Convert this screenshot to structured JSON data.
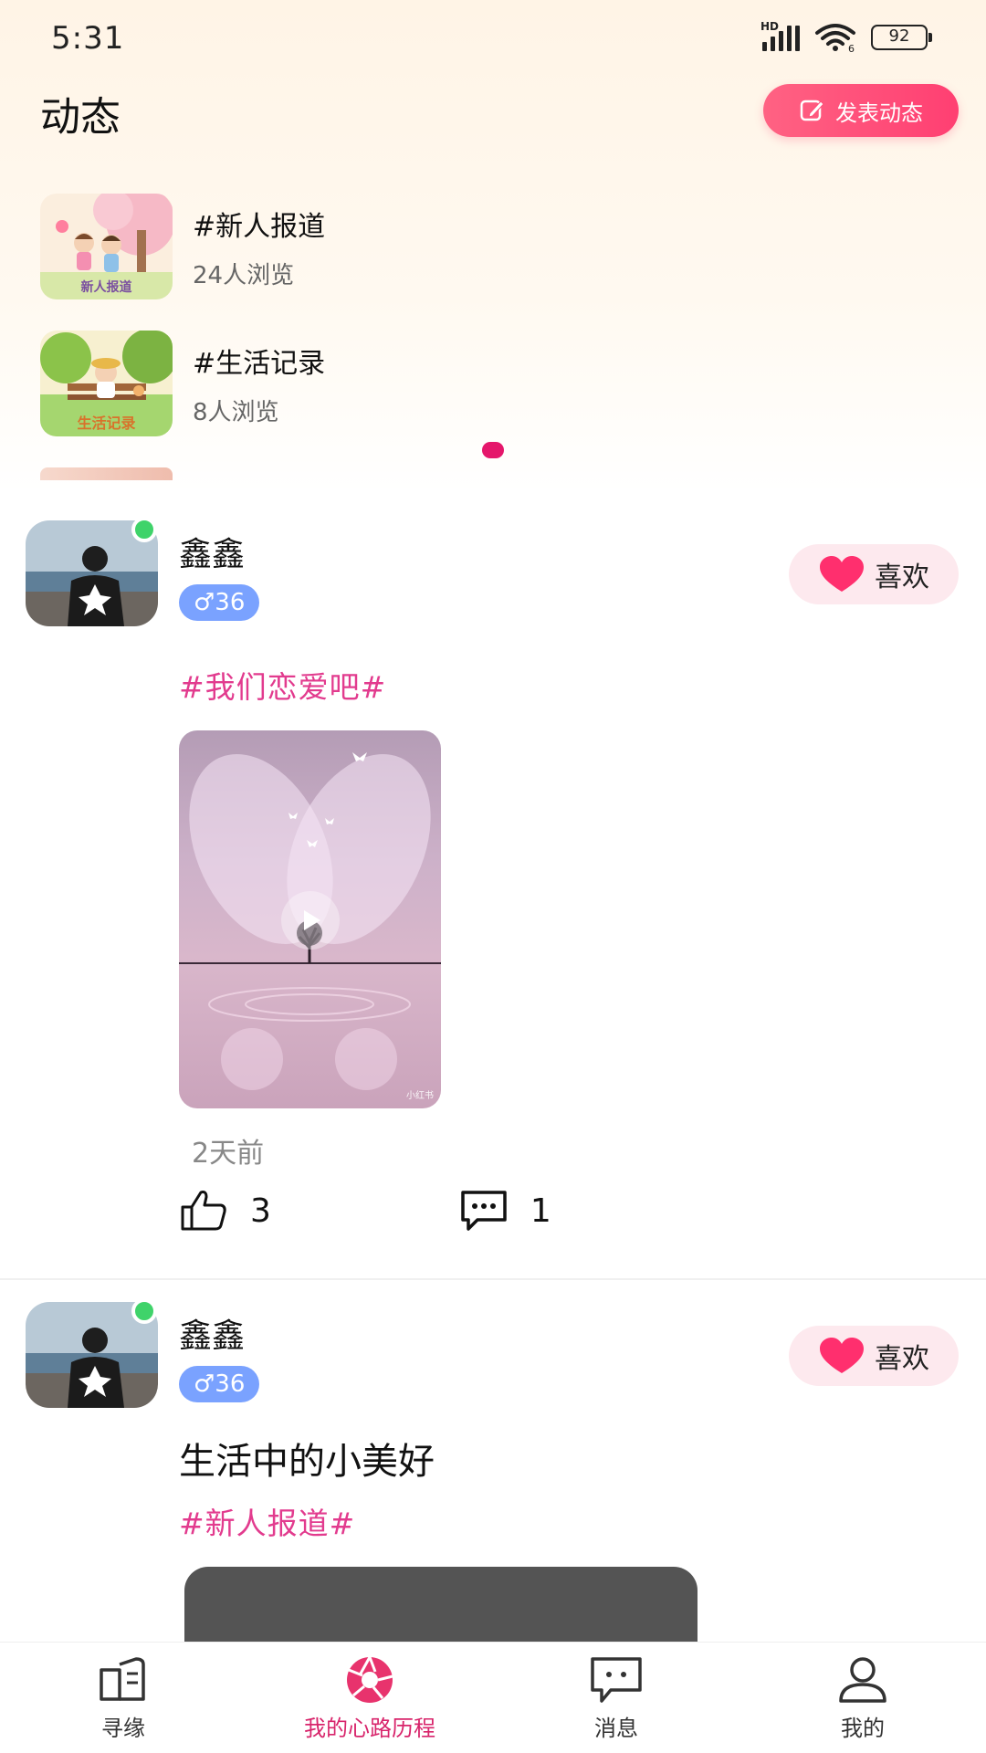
{
  "status_bar": {
    "time": "5:31",
    "network": "HD",
    "wifi_badge": "6",
    "battery": "92"
  },
  "header": {
    "title": "动态",
    "post_button": "发表动态"
  },
  "topics": [
    {
      "name": "#新人报道",
      "views": "24人浏览",
      "thumb_caption": "新人报道"
    },
    {
      "name": "#生活记录",
      "views": "8人浏览",
      "thumb_caption": "生活记录"
    }
  ],
  "posts": [
    {
      "username": "鑫鑫",
      "badge": "♂36",
      "like_label": "喜欢",
      "content": "",
      "tag": "#我们恋爱吧#",
      "video_watermark": "小红书",
      "time": "2天前",
      "likes": "3",
      "comments": "1"
    },
    {
      "username": "鑫鑫",
      "badge": "♂36",
      "like_label": "喜欢",
      "content": "生活中的小美好",
      "tag": "#新人报道#"
    }
  ],
  "tabs": [
    {
      "label": "寻缘",
      "icon": "book-icon"
    },
    {
      "label": "我的心路历程",
      "icon": "aperture-icon",
      "active": true
    },
    {
      "label": "消息",
      "icon": "chat-icon"
    },
    {
      "label": "我的",
      "icon": "user-icon"
    }
  ],
  "colors": {
    "accent": "#e23b8e",
    "primary_button": "#ff4f78",
    "badge": "#7aa2ff",
    "active_tab": "#d8246b"
  }
}
